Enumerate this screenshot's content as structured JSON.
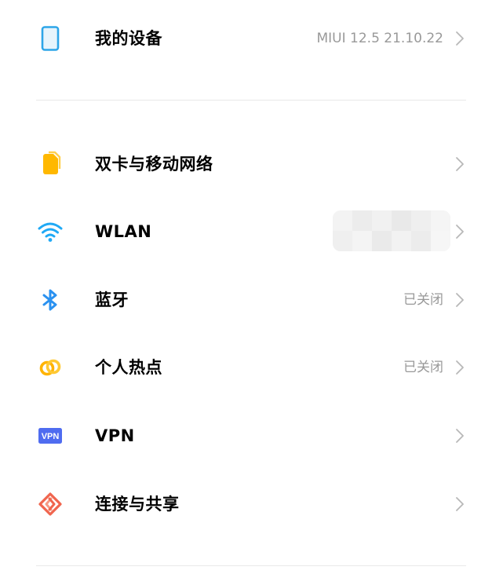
{
  "my_device": {
    "label": "我的设备",
    "value": "MIUI 12.5 21.10.22",
    "icon": "tablet-icon"
  },
  "connections": [
    {
      "key": "sim",
      "label": "双卡与移动网络",
      "value": "",
      "icon": "sim-card-icon"
    },
    {
      "key": "wlan",
      "label": "WLAN",
      "value": "",
      "icon": "wifi-icon"
    },
    {
      "key": "bluetooth",
      "label": "蓝牙",
      "value": "已关闭",
      "icon": "bluetooth-icon"
    },
    {
      "key": "hotspot",
      "label": "个人热点",
      "value": "已关闭",
      "icon": "hotspot-icon"
    },
    {
      "key": "vpn",
      "label": "VPN",
      "value": "",
      "icon": "vpn-icon",
      "icon_text": "VPN"
    },
    {
      "key": "share",
      "label": "连接与共享",
      "value": "",
      "icon": "connection-share-icon"
    }
  ],
  "colors": {
    "device_icon": "#2da5e8",
    "sim_icon": "#ffb800",
    "wifi_icon": "#1fa9f5",
    "bluetooth_icon": "#2a91f0",
    "hotspot_icon": "#ffb300",
    "vpn_icon": "#4f6cf0",
    "share_icon": "#f0654e",
    "secondary_text": "#999999",
    "chevron": "#b8b8b8",
    "divider": "#e8e8e8"
  }
}
